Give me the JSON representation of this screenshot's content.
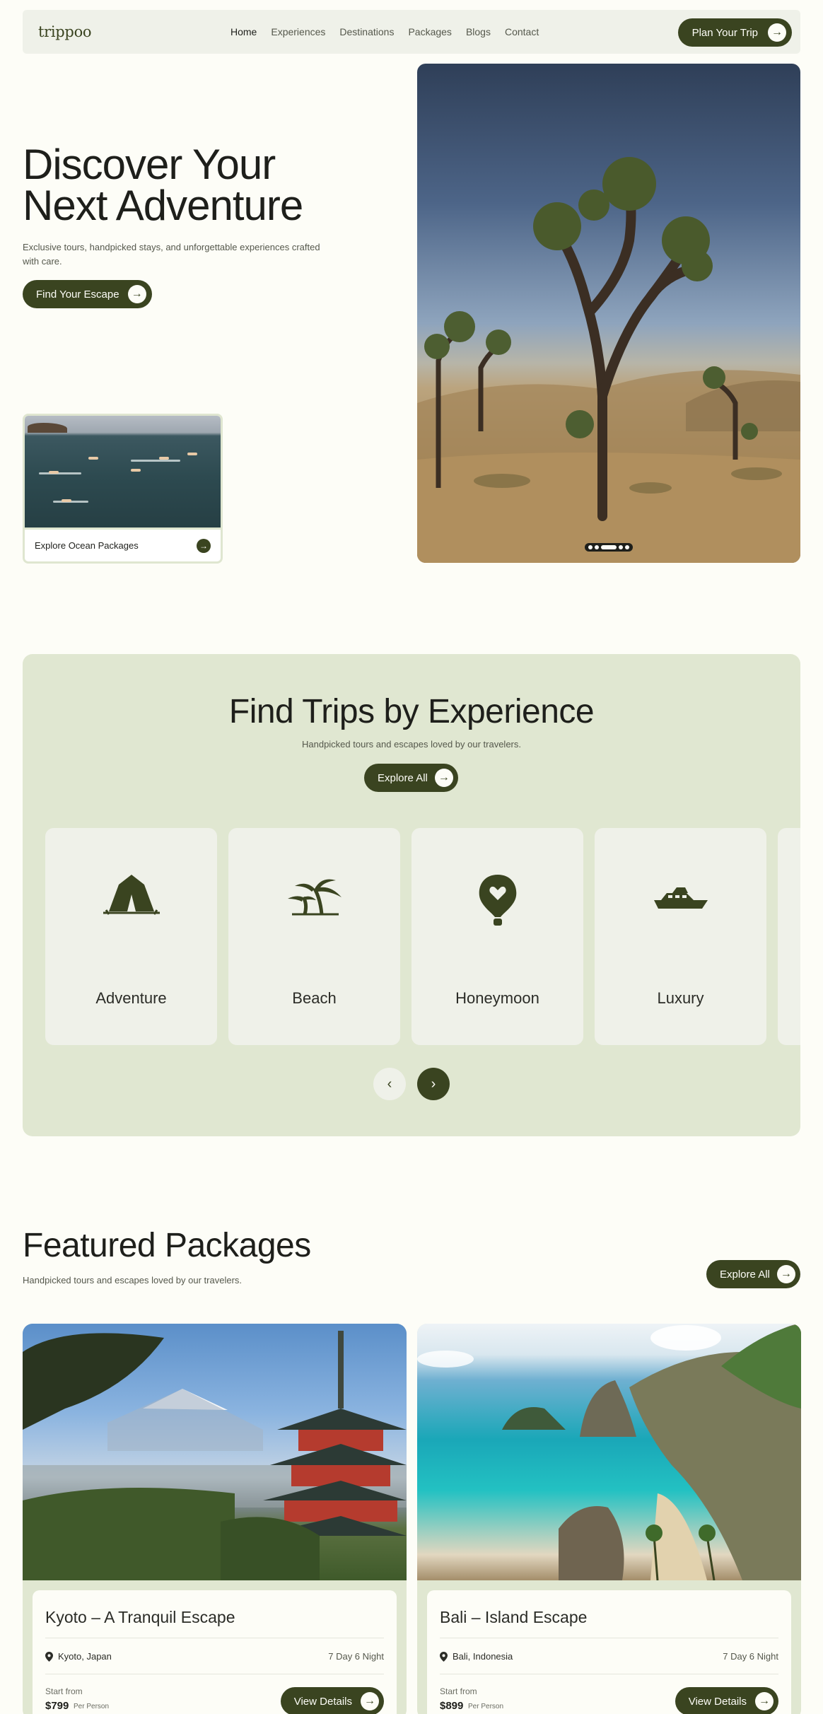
{
  "nav": {
    "logo": "trippoo",
    "links": [
      "Home",
      "Experiences",
      "Destinations",
      "Packages",
      "Blogs",
      "Contact"
    ],
    "cta": "Plan Your Trip"
  },
  "hero": {
    "title_line1": "Discover Your",
    "title_line2": "Next Adventure",
    "subtitle": "Exclusive tours, handpicked stays, and unforgettable experiences crafted with care.",
    "cta": "Find Your Escape",
    "ocean_card_label": "Explore Ocean Packages"
  },
  "experience": {
    "title": "Find Trips by Experience",
    "subtitle": "Handpicked tours and escapes loved by our travelers.",
    "cta": "Explore All",
    "cards": [
      {
        "label": "Adventure",
        "icon": "tent-icon"
      },
      {
        "label": "Beach",
        "icon": "palm-tree-icon"
      },
      {
        "label": "Honeymoon",
        "icon": "heart-balloon-icon"
      },
      {
        "label": "Luxury",
        "icon": "yacht-icon"
      }
    ]
  },
  "featured": {
    "title": "Featured Packages",
    "subtitle": "Handpicked tours and escapes loved by our travelers.",
    "cta": "Explore All",
    "packages": [
      {
        "name": "Kyoto – A Tranquil Escape",
        "location": "Kyoto, Japan",
        "duration": "7 Day 6 Night",
        "start_label": "Start from",
        "price": "$799",
        "per": "Per Person",
        "cta": "View Details"
      },
      {
        "name": "Bali – Island Escape",
        "location": "Bali, Indonesia",
        "duration": "7 Day 6 Night",
        "start_label": "Start from",
        "price": "$899",
        "per": "Per Person",
        "cta": "View Details"
      }
    ]
  },
  "colors": {
    "accent": "#3a4420",
    "background": "#fdfdf7",
    "section_bg": "#e0e7d1",
    "card_bg": "#eff1e9"
  }
}
